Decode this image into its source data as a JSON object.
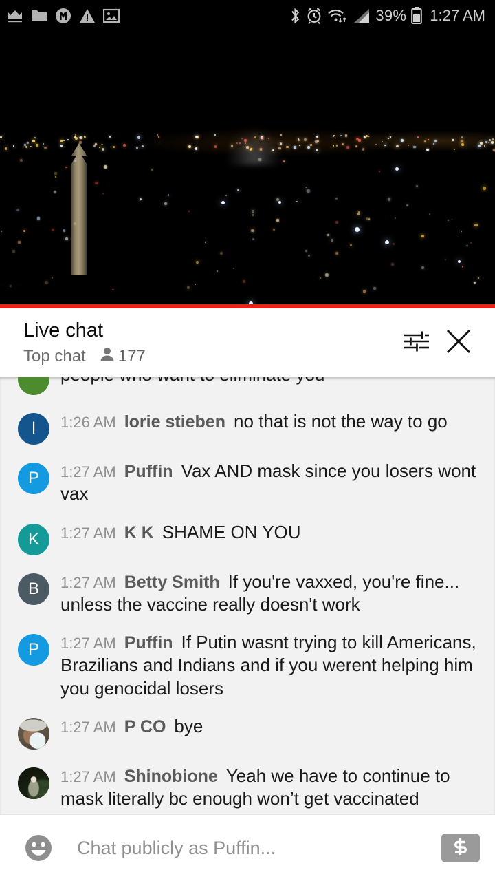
{
  "status_bar": {
    "left_icons": [
      "crown-icon",
      "folder-icon",
      "m-circle-icon",
      "warning-triangle-icon",
      "image-icon"
    ],
    "right_icons": [
      "bluetooth-icon",
      "alarm-clock-icon",
      "wifi-icon",
      "cellular-signal-icon"
    ],
    "battery_percent": "39%",
    "battery_icon": "battery-icon",
    "time": "1:27 AM"
  },
  "video": {
    "name": "live-stream-washington-monument-night",
    "progress_percent": 100,
    "progress_color": "#e62117"
  },
  "chat_header": {
    "title": "Live chat",
    "mode": "Top chat",
    "viewer_icon": "person-icon",
    "viewer_count": "177",
    "settings_icon": "chat-settings-sliders-icon",
    "close_icon": "close-icon"
  },
  "messages": [
    {
      "clipped": true,
      "timestamp": "",
      "author": "",
      "text": "people who want to eliminate you",
      "avatar": {
        "type": "letter",
        "letter": "",
        "color": "#4d8b2f"
      }
    },
    {
      "clipped": false,
      "timestamp": "1:26 AM",
      "author": "lorie stieben",
      "text": "no that is not the way to go",
      "avatar": {
        "type": "letter",
        "letter": "l",
        "color": "#15558d"
      }
    },
    {
      "clipped": false,
      "timestamp": "1:27 AM",
      "author": "Puffin",
      "text": "Vax AND mask since you losers wont vax",
      "avatar": {
        "type": "letter",
        "letter": "P",
        "color": "#139ae0"
      }
    },
    {
      "clipped": false,
      "timestamp": "1:27 AM",
      "author": "K K",
      "text": "SHAME ON YOU",
      "avatar": {
        "type": "letter",
        "letter": "K",
        "color": "#159a9a"
      }
    },
    {
      "clipped": false,
      "timestamp": "1:27 AM",
      "author": "Betty Smith",
      "text": "If you're vaxxed, you're fine... unless the vaccine really doesn't work",
      "avatar": {
        "type": "letter",
        "letter": "B",
        "color": "#4c5b63"
      }
    },
    {
      "clipped": false,
      "timestamp": "1:27 AM",
      "author": "Puffin",
      "text": "If Putin wasnt trying to kill Americans, Brazilians and Indians and if you werent helping him you genocidal losers",
      "avatar": {
        "type": "letter",
        "letter": "P",
        "color": "#139ae0"
      }
    },
    {
      "clipped": false,
      "timestamp": "1:27 AM",
      "author": "P CO",
      "text": "bye",
      "avatar": {
        "type": "photo",
        "letter": "",
        "color": "#8d8473",
        "photo": "man-with-hat-photo"
      }
    },
    {
      "clipped": false,
      "timestamp": "1:27 AM",
      "author": "Shinobione",
      "text": "Yeah we have to continue to mask literally bc enough won’t get vaccinated",
      "avatar": {
        "type": "photo",
        "letter": "",
        "color": "#1d2417",
        "photo": "dark-figure-photo"
      }
    }
  ],
  "input_bar": {
    "emoji_icon": "emoji-smiley-icon",
    "placeholder": "Chat publicly as Puffin...",
    "value": "",
    "superchat_icon": "dollar-sign-icon"
  }
}
